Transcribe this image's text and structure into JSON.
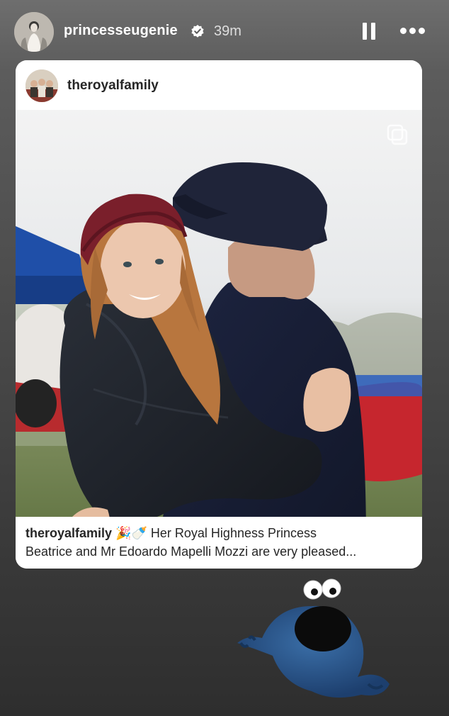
{
  "story": {
    "username": "princesseugenie",
    "timestamp": "39m",
    "pause_icon": "pause-icon",
    "more_icon": "more-horizontal-icon",
    "verified_icon": "verified-badge-icon"
  },
  "shared_post": {
    "username": "theroyalfamily",
    "multi_photo_icon": "carousel-icon",
    "caption": {
      "username": "theroyalfamily",
      "emojis": "🎉🍼",
      "text_line1": "Her Royal Highness Princess",
      "text_line2": "Beatrice and Mr Edoardo Mapelli Mozzi are very pleased..."
    }
  },
  "sticker": {
    "icon": "cookie-monster-sticker"
  }
}
